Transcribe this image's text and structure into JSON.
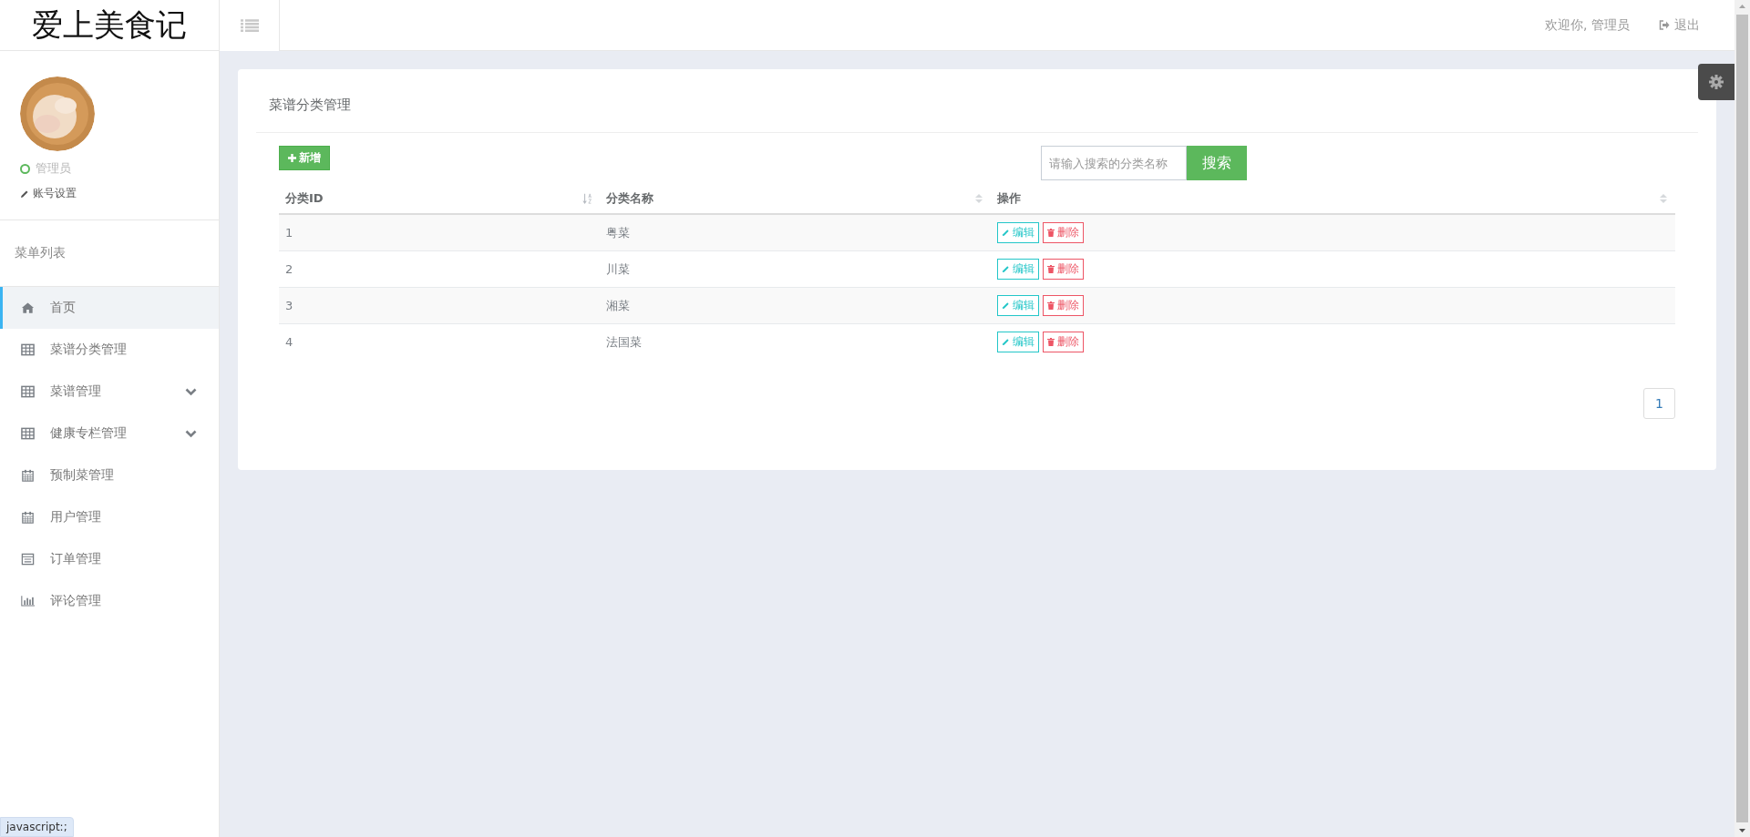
{
  "brand": "爱上美食记",
  "topbar": {
    "welcome": "欢迎你, 管理员",
    "logout": "退出"
  },
  "profile": {
    "role": "管理员",
    "online": true,
    "settings": "账号设置"
  },
  "sidebar": {
    "heading": "菜单列表",
    "items": [
      {
        "label": "首页",
        "kind": "home",
        "selected": true,
        "expandable": false
      },
      {
        "label": "菜谱分类管理",
        "kind": "table",
        "selected": false,
        "expandable": false
      },
      {
        "label": "菜谱管理",
        "kind": "table",
        "selected": false,
        "expandable": true
      },
      {
        "label": "健康专栏管理",
        "kind": "table",
        "selected": false,
        "expandable": true
      },
      {
        "label": "预制菜管理",
        "kind": "calendar",
        "selected": false,
        "expandable": false
      },
      {
        "label": "用户管理",
        "kind": "calendar",
        "selected": false,
        "expandable": false
      },
      {
        "label": "订单管理",
        "kind": "list",
        "selected": false,
        "expandable": false
      },
      {
        "label": "评论管理",
        "kind": "chart",
        "selected": false,
        "expandable": false
      }
    ]
  },
  "card": {
    "title": "菜谱分类管理",
    "add_button": "新增",
    "search": {
      "placeholder": "请输入搜索的分类名称",
      "button": "搜索"
    },
    "table": {
      "columns": [
        "分类ID",
        "分类名称",
        "操作"
      ],
      "rows": [
        {
          "id": "1",
          "name": "粤菜",
          "actions": [
            {
              "kind": "edit",
              "label": "编辑"
            },
            {
              "kind": "delete",
              "label": "删除"
            }
          ]
        },
        {
          "id": "2",
          "name": "川菜",
          "actions": [
            {
              "kind": "edit",
              "label": "编辑"
            },
            {
              "kind": "delete",
              "label": "删除"
            }
          ]
        },
        {
          "id": "3",
          "name": "湘菜",
          "actions": [
            {
              "kind": "edit",
              "label": "编辑"
            },
            {
              "kind": "delete",
              "label": "删除"
            }
          ]
        },
        {
          "id": "4",
          "name": "法国菜",
          "actions": [
            {
              "kind": "edit",
              "label": "编辑"
            },
            {
              "kind": "delete",
              "label": "删除"
            }
          ]
        }
      ]
    },
    "pagination": [
      "1"
    ]
  },
  "status_bar": "javascript:;"
}
